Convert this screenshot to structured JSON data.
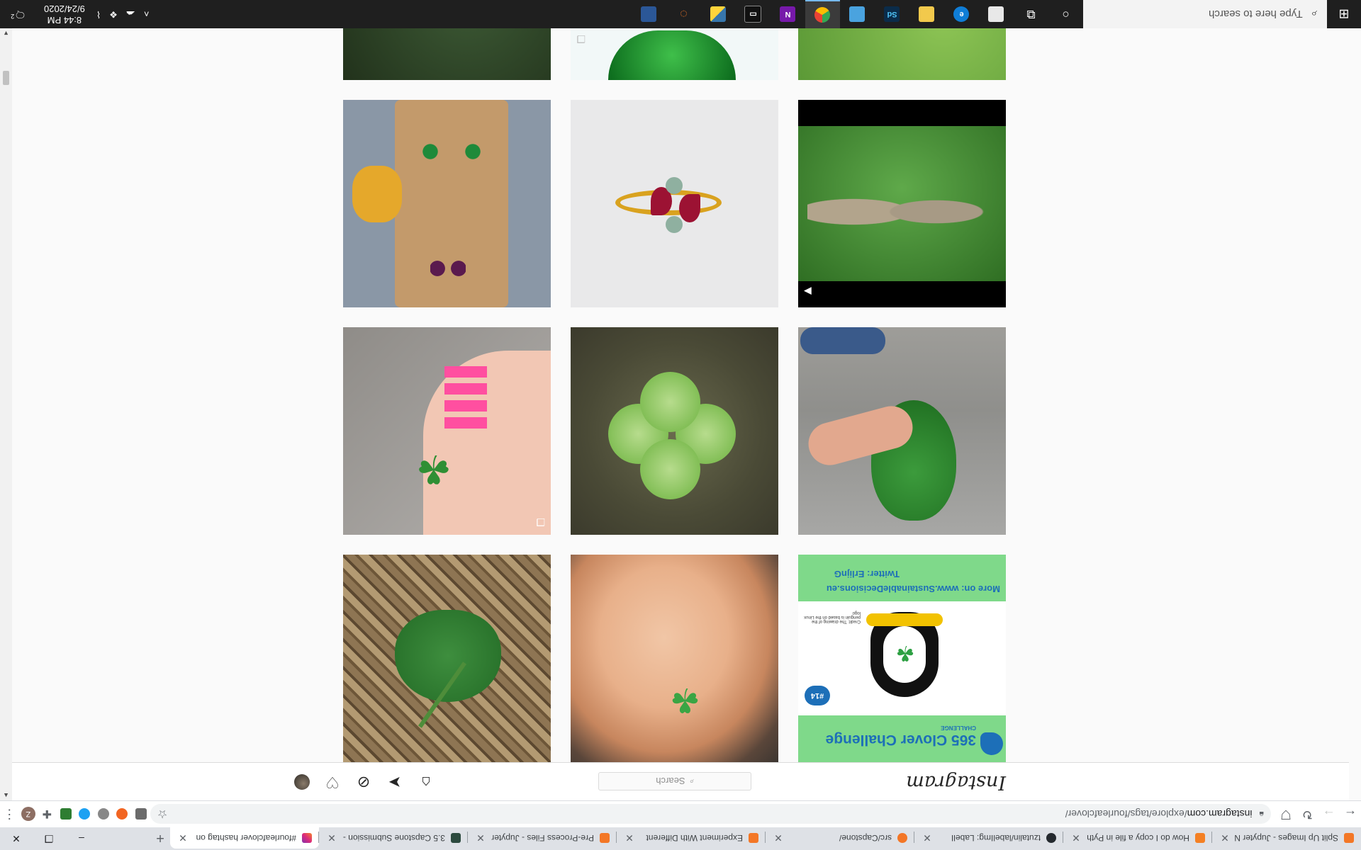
{
  "browser": {
    "tabs": [
      {
        "title": "Split Up Images - Jupyter N",
        "color": "#f37726",
        "active": false
      },
      {
        "title": "How do I copy a file in Pyth",
        "color": "#f48024",
        "active": false
      },
      {
        "title": "tzutalin/labelImg: LabelI",
        "color": "#24292e",
        "active": false
      },
      {
        "title": "src/Capstone/",
        "color": "#f37626",
        "active": false
      },
      {
        "title": "Experiment With Different",
        "color": "#f37726",
        "active": false
      },
      {
        "title": "Pre-Process Files - Jupyter",
        "color": "#f37726",
        "active": false
      },
      {
        "title": "3.5 Capstone Submission -",
        "color": "#2c4a3e",
        "active": false
      },
      {
        "title": "#fourleafclover hashtag on",
        "color": "#c13584",
        "active": true
      }
    ],
    "new_tab_label": "+",
    "window_controls": {
      "minimize": "–",
      "restore": "❐",
      "close": "✕"
    },
    "url_host": "instagram.com",
    "url_path": "/explore/tags/fourleafclover/",
    "extension_avatar_letter": "Z"
  },
  "instagram": {
    "logo": "Instagram",
    "search_placeholder": "Search"
  },
  "grid_cells": [
    {
      "name": "photo-clover-challenge-poster",
      "badge": ""
    },
    {
      "name": "photo-clover-in-child-hands",
      "badge": ""
    },
    {
      "name": "photo-clover-leaf-on-basket",
      "badge": ""
    },
    {
      "name": "photo-hand-holding-clovers",
      "badge": ""
    },
    {
      "name": "photo-four-leaf-clover-closeup",
      "badge": ""
    },
    {
      "name": "photo-pink-nails-holding-clover",
      "badge": "❐"
    },
    {
      "name": "photo-tortoises-in-clover",
      "badge": "▶"
    },
    {
      "name": "photo-ruby-clover-ring",
      "badge": ""
    },
    {
      "name": "photo-clover-earrings-display",
      "badge": ""
    },
    {
      "name": "photo-clover-leaves-top",
      "badge": ""
    },
    {
      "name": "photo-green-clover-glass",
      "badge": "❐"
    },
    {
      "name": "photo-clover-patch-top",
      "badge": ""
    }
  ],
  "poster": {
    "title": "365 Clover Challenge",
    "challenge_label": "CHALLENGE",
    "day_badge": "#14",
    "credit": "Credit: The drawing of the penguin is based on the Linux logo",
    "website": "More on: www.SustainableDecisions.eu",
    "twitter": "Twitter: ErlijnG"
  },
  "taskbar": {
    "search_placeholder": "Type here to search",
    "time": "8:44 PM",
    "date": "9/24/2020",
    "notification_count": "2",
    "apps": [
      {
        "name": "cortana",
        "label": "○",
        "color": "transparent"
      },
      {
        "name": "task-view",
        "label": "⧉",
        "color": "transparent"
      },
      {
        "name": "file-app",
        "label": "",
        "color": "#e8e8e8"
      },
      {
        "name": "edge",
        "label": "e",
        "color": "#0f7dd6"
      },
      {
        "name": "file-explorer",
        "label": "",
        "color": "#f2c94c"
      },
      {
        "name": "photoshop-sd",
        "label": "Sd",
        "color": "#0b2c4a"
      },
      {
        "name": "weather-app",
        "label": "",
        "color": "#4aa3df"
      },
      {
        "name": "chrome",
        "label": "",
        "color": "#e94235"
      },
      {
        "name": "onenote",
        "label": "N",
        "color": "#7719aa"
      },
      {
        "name": "terminal",
        "label": "▭",
        "color": "#111111"
      },
      {
        "name": "python",
        "label": "",
        "color": "#3776ab"
      },
      {
        "name": "jupyter",
        "label": "",
        "color": "#f37726"
      },
      {
        "name": "calculator",
        "label": "",
        "color": "#2b5797"
      }
    ]
  }
}
